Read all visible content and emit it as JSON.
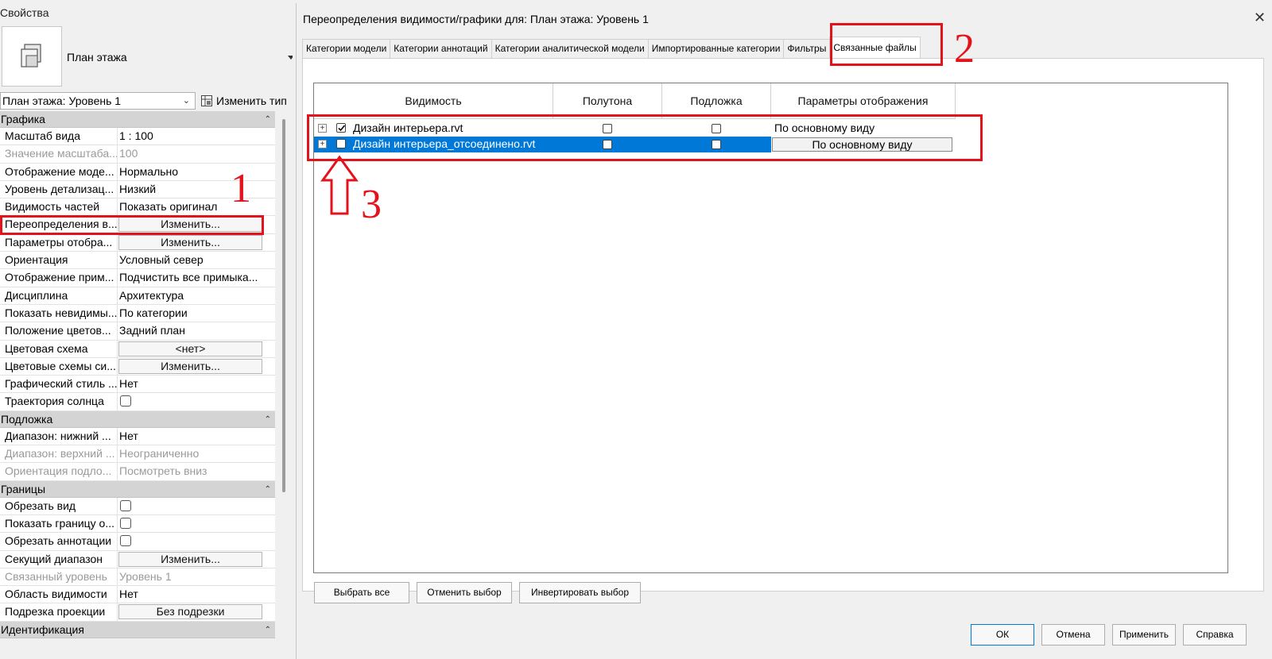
{
  "props": {
    "title": "Свойства",
    "type_name": "План этажа",
    "selector": "План этажа: Уровень 1",
    "edit_type": "Изменить тип",
    "sections": [
      {
        "title": "Графика",
        "rows": [
          {
            "name": "Масштаб вида",
            "value": "1 : 100",
            "kind": "text",
            "dim": false
          },
          {
            "name": "Значение масштаба...",
            "value": "100",
            "kind": "text",
            "dim": true
          },
          {
            "name": "Отображение моде...",
            "value": "Нормально",
            "kind": "text",
            "dim": false
          },
          {
            "name": "Уровень детализац...",
            "value": "Низкий",
            "kind": "text",
            "dim": false
          },
          {
            "name": "Видимость частей",
            "value": "Показать оригинал",
            "kind": "text",
            "dim": false
          },
          {
            "name": "Переопределения в...",
            "value": "Изменить...",
            "kind": "button",
            "dim": false
          },
          {
            "name": "Параметры отобра...",
            "value": "Изменить...",
            "kind": "button",
            "dim": false
          },
          {
            "name": "Ориентация",
            "value": "Условный север",
            "kind": "text",
            "dim": false
          },
          {
            "name": "Отображение прим...",
            "value": "Подчистить все примыка...",
            "kind": "text",
            "dim": false
          },
          {
            "name": "Дисциплина",
            "value": "Архитектура",
            "kind": "text",
            "dim": false
          },
          {
            "name": "Показать невидимы...",
            "value": "По категории",
            "kind": "text",
            "dim": false
          },
          {
            "name": "Положение цветов...",
            "value": "Задний план",
            "kind": "text",
            "dim": false
          },
          {
            "name": "Цветовая схема",
            "value": "<нет>",
            "kind": "button",
            "dim": false
          },
          {
            "name": "Цветовые схемы си...",
            "value": "Изменить...",
            "kind": "button",
            "dim": false
          },
          {
            "name": "Графический стиль ...",
            "value": "Нет",
            "kind": "text",
            "dim": false
          },
          {
            "name": "Траектория солнца",
            "value": "",
            "kind": "check",
            "dim": false
          }
        ]
      },
      {
        "title": "Подложка",
        "rows": [
          {
            "name": "Диапазон: нижний ...",
            "value": "Нет",
            "kind": "text",
            "dim": false
          },
          {
            "name": "Диапазон: верхний ...",
            "value": "Неограниченно",
            "kind": "text",
            "dim": true
          },
          {
            "name": "Ориентация подло...",
            "value": "Посмотреть вниз",
            "kind": "text",
            "dim": true
          }
        ]
      },
      {
        "title": "Границы",
        "rows": [
          {
            "name": "Обрезать вид",
            "value": "",
            "kind": "check",
            "dim": false
          },
          {
            "name": "Показать границу о...",
            "value": "",
            "kind": "check",
            "dim": false
          },
          {
            "name": "Обрезать аннотации",
            "value": "",
            "kind": "check",
            "dim": false
          },
          {
            "name": "Секущий диапазон",
            "value": "Изменить...",
            "kind": "button",
            "dim": false
          },
          {
            "name": "Связанный уровень",
            "value": "Уровень 1",
            "kind": "text",
            "dim": true
          },
          {
            "name": "Область видимости",
            "value": "Нет",
            "kind": "text",
            "dim": false
          },
          {
            "name": "Подрезка проекции",
            "value": "Без подрезки",
            "kind": "button",
            "dim": false
          }
        ]
      },
      {
        "title": "Идентификация",
        "rows": []
      }
    ]
  },
  "dialog": {
    "title": "Переопределения видимости/графики для: План этажа: Уровень 1",
    "close": "✕",
    "tabs": [
      {
        "label": "Категории модели",
        "active": false
      },
      {
        "label": "Категории аннотаций",
        "active": false
      },
      {
        "label": "Категории аналитической модели",
        "active": false
      },
      {
        "label": "Импортированные категории",
        "active": false
      },
      {
        "label": "Фильтры",
        "active": false
      },
      {
        "label": "Связанные файлы",
        "active": true
      }
    ],
    "columns": [
      "Видимость",
      "Полутона",
      "Подложка",
      "Параметры отображения"
    ],
    "rows": [
      {
        "name": "Дизайн интерьера.rvt",
        "visible": true,
        "halftone": false,
        "underlay": false,
        "display": "По основному виду",
        "selected": false
      },
      {
        "name": "Дизайн интерьера_отсоединено.rvt",
        "visible": false,
        "halftone": false,
        "underlay": false,
        "display": "По основному виду",
        "selected": true
      }
    ],
    "list_buttons": [
      "Выбрать все",
      "Отменить выбор",
      "Инвертировать выбор"
    ],
    "footer_buttons": [
      "ОК",
      "Отмена",
      "Применить",
      "Справка"
    ]
  },
  "annotations": {
    "labels": [
      "1",
      "2",
      "3"
    ],
    "color": "#e3121b"
  },
  "colors": {
    "selection": "#0078d7",
    "section_header": "#d4d4d4"
  }
}
